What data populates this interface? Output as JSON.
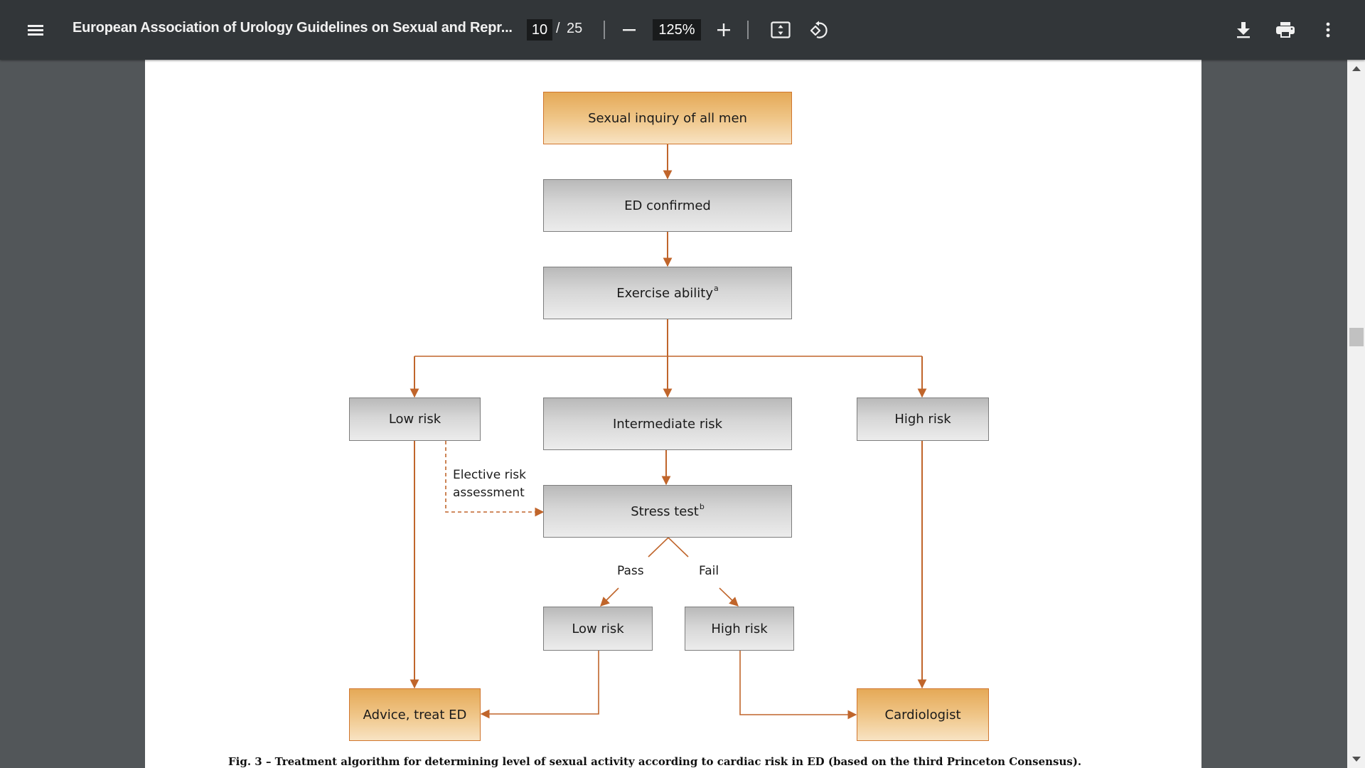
{
  "toolbar": {
    "menu_icon": "hamburger-menu-icon",
    "title": "European Association of Urology Guidelines on Sexual and Repr...",
    "current_page": "10",
    "page_separator": "/",
    "total_pages": "25",
    "zoom_out_icon": "minus-icon",
    "zoom_level": "125%",
    "zoom_in_icon": "plus-icon",
    "fit_page_icon": "fit-to-page-icon",
    "rotate_icon": "rotate-counterclockwise-icon",
    "download_icon": "download-icon",
    "print_icon": "print-icon",
    "more_icon": "more-vertical-icon"
  },
  "colors": {
    "toolbar_bg": "#323639",
    "viewer_bg": "#525659",
    "arrow": "#c0652b",
    "accent_box": "#efc587",
    "neutral_box": "#d6d6d6"
  },
  "flowchart": {
    "nodes": {
      "sexual_inquiry": "Sexual inquiry of all men",
      "ed_confirmed": "ED confirmed",
      "exercise_ability": "Exercise ability",
      "exercise_ability_sup": "a",
      "low_risk": "Low risk",
      "intermediate_risk": "Intermediate risk",
      "high_risk": "High risk",
      "stress_test": "Stress test",
      "stress_test_sup": "b",
      "stress_low_risk": "Low risk",
      "stress_high_risk": "High risk",
      "advice_treat_ed": "Advice, treat ED",
      "cardiologist": "Cardiologist"
    },
    "labels": {
      "elective_line1": "Elective risk",
      "elective_line2": "assessment",
      "pass": "Pass",
      "fail": "Fail"
    }
  },
  "caption": "Fig. 3 – Treatment algorithm for determining level of sexual activity according to cardiac risk in ED (based on the third Princeton Consensus)."
}
